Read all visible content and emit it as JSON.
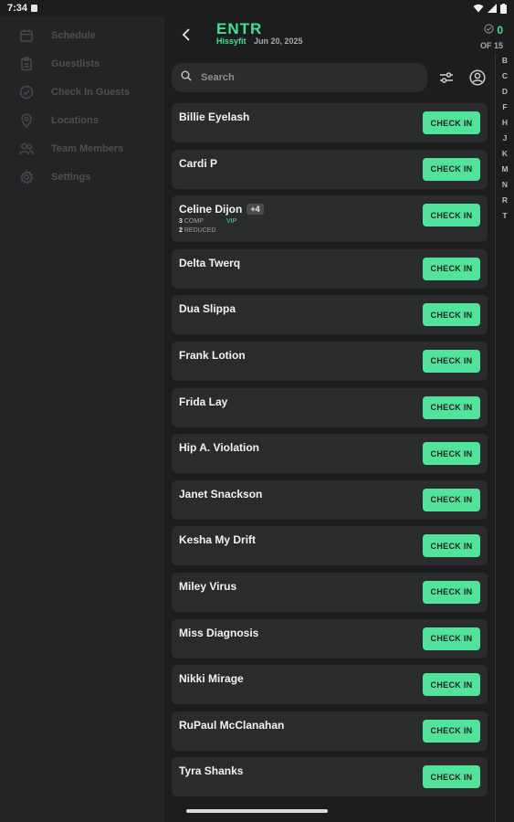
{
  "status_bar": {
    "time": "7:34"
  },
  "sidebar": {
    "items": [
      {
        "label": "Schedule",
        "icon": "calendar-icon"
      },
      {
        "label": "Guestlists",
        "icon": "clipboard-icon"
      },
      {
        "label": "Check In Guests",
        "icon": "check-circle-icon"
      },
      {
        "label": "Locations",
        "icon": "location-pin-icon"
      },
      {
        "label": "Team Members",
        "icon": "people-icon"
      },
      {
        "label": "Settings",
        "icon": "gear-icon"
      }
    ]
  },
  "header": {
    "title": "ENTR",
    "organizer": "Hissyfit",
    "date": "Jun 20, 2025",
    "checked_in_count": "0",
    "total": "OF 15"
  },
  "search": {
    "placeholder": "Search",
    "value": ""
  },
  "guests": [
    {
      "name": "Billie Eyelash",
      "button": "CHECK IN"
    },
    {
      "name": "Cardi P",
      "button": "CHECK IN"
    },
    {
      "name": "Celine Dijon",
      "plus": "+4",
      "comp_count": "3",
      "comp_label": "COMP",
      "reduced_count": "2",
      "reduced_label": "REDUCED",
      "tag": "VIP",
      "button": "CHECK IN"
    },
    {
      "name": "Delta Twerq",
      "button": "CHECK IN"
    },
    {
      "name": "Dua Slippa",
      "button": "CHECK IN"
    },
    {
      "name": "Frank Lotion",
      "button": "CHECK IN"
    },
    {
      "name": "Frida Lay",
      "button": "CHECK IN"
    },
    {
      "name": "Hip A. Violation",
      "button": "CHECK IN"
    },
    {
      "name": "Janet Snackson",
      "button": "CHECK IN"
    },
    {
      "name": "Kesha My Drift",
      "button": "CHECK IN"
    },
    {
      "name": "Miley Virus",
      "button": "CHECK IN"
    },
    {
      "name": "Miss Diagnosis",
      "button": "CHECK IN"
    },
    {
      "name": "Nikki Mirage",
      "button": "CHECK IN"
    },
    {
      "name": "RuPaul McClanahan",
      "button": "CHECK IN"
    },
    {
      "name": "Tyra Shanks",
      "button": "CHECK IN"
    }
  ],
  "alphabet_index": [
    "B",
    "C",
    "D",
    "F",
    "H",
    "J",
    "K",
    "M",
    "N",
    "R",
    "T"
  ],
  "colors": {
    "accent": "#45e08f",
    "button": "#52e39a",
    "background": "#1c1d1e",
    "card": "#2a2b2d"
  }
}
